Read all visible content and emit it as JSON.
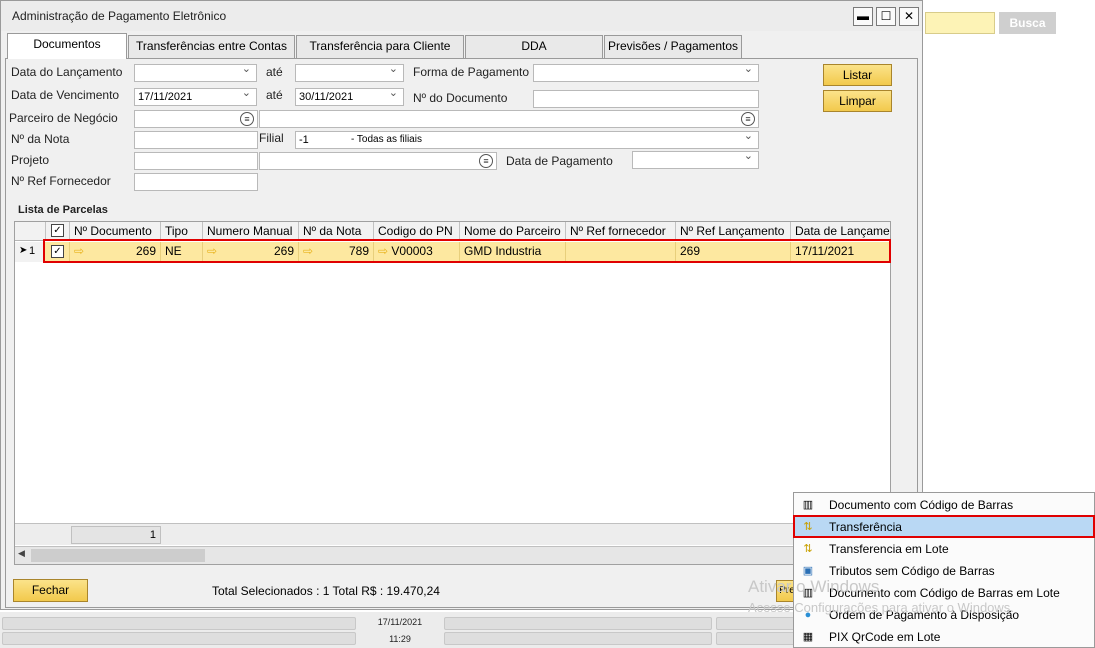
{
  "window": {
    "title": "Administração de Pagamento Eletrônico",
    "minimize": "▬",
    "maximize": "☐",
    "close": "✕"
  },
  "background_app": {
    "search_button": "Busca"
  },
  "tabs": [
    {
      "label": "Documentos",
      "active": true
    },
    {
      "label": "Transferências entre Contas"
    },
    {
      "label": "Transferência para Cliente"
    },
    {
      "label": "DDA"
    },
    {
      "label": "Previsões / Pagamentos"
    }
  ],
  "form": {
    "data_lancamento_label": "Data do Lançamento",
    "data_lancamento_from": "",
    "ate1": "até",
    "data_lancamento_to": "",
    "forma_pagamento_label": "Forma de Pagamento",
    "forma_pagamento_value": "",
    "data_vencimento_label": "Data de Vencimento",
    "data_vencimento_from": "17/11/2021",
    "ate2": "até",
    "data_vencimento_to": "30/11/2021",
    "numero_documento_label": "Nº do Documento",
    "numero_documento_value": "",
    "parceiro_label": "Parceiro de Negócio",
    "nota_label": "Nº da Nota",
    "filial_label": "Filial",
    "filial_code": "-1",
    "filial_desc": "- Todas as filiais",
    "projeto_label": "Projeto",
    "data_pagamento_label": "Data de Pagamento",
    "ref_fornecedor_label": "Nº Ref Fornecedor",
    "listar": "Listar",
    "limpar": "Limpar"
  },
  "grid": {
    "title": "Lista de Parcelas",
    "headers": [
      "Nº Documento",
      "Tipo",
      "Numero Manual",
      "Nº da Nota",
      "Codigo do PN",
      "Nome do Parceiro",
      "Nº Ref fornecedor",
      "Nº Ref Lançamento",
      "Data de Lançamento"
    ],
    "rows": [
      {
        "row_marker": "➤",
        "row_number": "1",
        "checked": "✓",
        "numero_documento": "269",
        "tipo": "NE",
        "numero_manual": "269",
        "numero_nota": "789",
        "codigo_pn": "V00003",
        "nome_parceiro": "GMD Industria",
        "ref_fornecedor": "",
        "ref_lancamento": "269",
        "data_lancamento": "17/11/2021"
      }
    ],
    "footer_total": "1"
  },
  "bottom": {
    "fechar": "Fechar",
    "total_text": "Total Selecionados : 1 Total R$ : 19.470,24",
    "partial_button": "Pre"
  },
  "status": {
    "date": "17/11/2021",
    "time": "11:29"
  },
  "menu": [
    {
      "label": "Documento com Código de Barras",
      "icon": "barcode-icon",
      "glyph": "▥"
    },
    {
      "label": "Transferência",
      "icon": "transfer-icon",
      "glyph": "⇅",
      "selected": true
    },
    {
      "label": "Transferencia em Lote",
      "icon": "transfer-batch-icon",
      "glyph": "⇅"
    },
    {
      "label": "Tributos sem Código de Barras",
      "icon": "tax-icon",
      "glyph": "▣"
    },
    {
      "label": "Documento com Código de Barras em Lote",
      "icon": "barcode-batch-icon",
      "glyph": "▥"
    },
    {
      "label": "Ordem de Pagamento à Disposição",
      "icon": "payment-order-icon",
      "glyph": "●"
    },
    {
      "label": "PIX QrCode em Lote",
      "icon": "qrcode-icon",
      "glyph": "▦"
    }
  ],
  "watermark": {
    "line1": "Ativar o Windows",
    "line2": "Acesse Configurações para ativar o Windows."
  },
  "colors": {
    "highlight_row": "#fde8a0",
    "selection_border": "#e00000",
    "menu_selected": "#b9d8f4",
    "button_yellow": "#f2c94c"
  }
}
